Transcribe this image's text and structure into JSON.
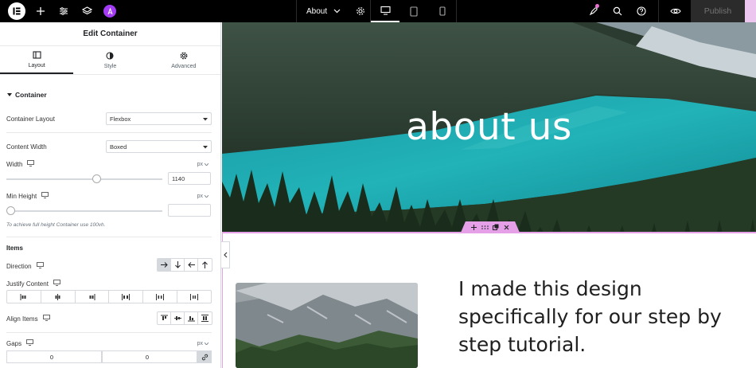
{
  "topbar": {
    "page_name": "About",
    "publish_label": "Publish",
    "colors": {
      "background": "#000000",
      "ai_badge": "#a33cf4",
      "publish_arrow": "#ecc6ef"
    }
  },
  "panel": {
    "title": "Edit Container",
    "tabs": [
      {
        "label": "Layout",
        "icon": "layout-icon",
        "active": true
      },
      {
        "label": "Style",
        "icon": "style-icon",
        "active": false
      },
      {
        "label": "Advanced",
        "icon": "gear-icon",
        "active": false
      }
    ],
    "section_title": "Container",
    "container_layout": {
      "label": "Container Layout",
      "value": "Flexbox"
    },
    "content_width": {
      "label": "Content Width",
      "value": "Boxed"
    },
    "width": {
      "label": "Width",
      "unit": "px",
      "value": "1140",
      "level": 0.58
    },
    "min_height": {
      "label": "Min Height",
      "unit": "px",
      "value": "",
      "level": 0
    },
    "hint": "To achieve full height Container use 100vh.",
    "items_heading": "Items",
    "direction": {
      "label": "Direction"
    },
    "justify_content": {
      "label": "Justify Content"
    },
    "align_items": {
      "label": "Align Items"
    },
    "gaps": {
      "label": "Gaps",
      "unit": "px",
      "column": "0",
      "row": "0"
    }
  },
  "canvas": {
    "hero_title": "about us",
    "body_text": "I made this design specifically for our step by step tutorial.",
    "accent": "#e6a0e8"
  }
}
